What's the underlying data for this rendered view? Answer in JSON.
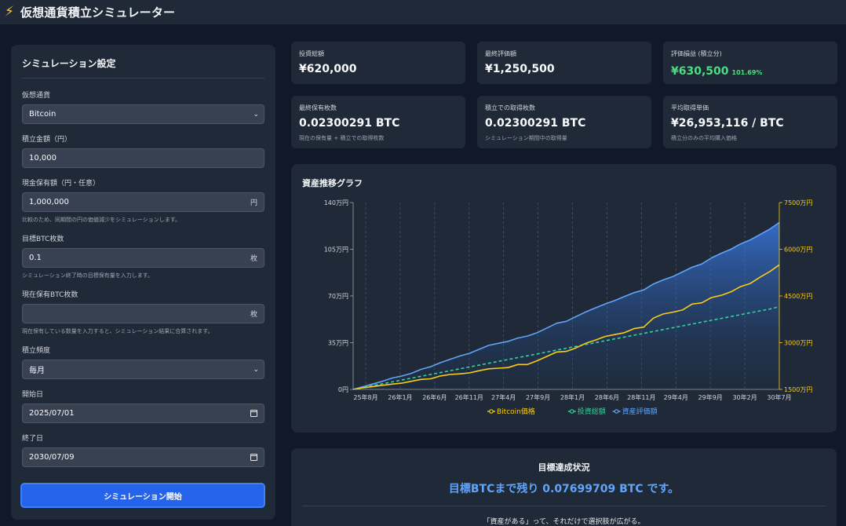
{
  "header": {
    "title": "仮想通貨積立シミュレーター",
    "icon": "lightning-bolt-icon"
  },
  "sidebar": {
    "title": "シミュレーション設定",
    "currency": {
      "label": "仮想通貨",
      "value": "Bitcoin"
    },
    "amount": {
      "label": "積立金額（円）",
      "value": "10,000"
    },
    "cash": {
      "label": "現金保有額（円・任意）",
      "value": "1,000,000",
      "suffix": "円",
      "hint": "比較のため、同期間の円の価値減少をシミュレーションします。"
    },
    "target": {
      "label": "目標BTC枚数",
      "value": "0.1",
      "suffix": "枚",
      "hint": "シミュレーション終了時の目標保有量を入力します。"
    },
    "holding": {
      "label": "現在保有BTC枚数",
      "value": "",
      "suffix": "枚",
      "hint": "現在保有している数量を入力すると、シミュレーション結果に合算されます。"
    },
    "frequency": {
      "label": "積立頻度",
      "value": "毎月"
    },
    "start": {
      "label": "開始日",
      "value": "2025/07/01"
    },
    "end": {
      "label": "終了日",
      "value": "2030/07/09"
    },
    "button": "シミュレーション開始"
  },
  "stats": {
    "invested": {
      "label": "投資総額",
      "value": "¥620,000"
    },
    "final_value": {
      "label": "最終評価額",
      "value": "¥1,250,500"
    },
    "gain": {
      "label": "評価損益 (積立分)",
      "value": "¥630,500",
      "pct": "101.69%"
    },
    "holdings": {
      "label": "最終保有枚数",
      "value": "0.02300291 BTC",
      "sub": "現在の保有量 + 積立での取得枚数"
    },
    "acquired": {
      "label": "積立での取得枚数",
      "value": "0.02300291 BTC",
      "sub": "シミュレーション期間中の取得量"
    },
    "avg_price": {
      "label": "平均取得単価",
      "value": "¥26,953,116 / BTC",
      "sub": "積立分のみの平均購入価格"
    }
  },
  "chart": {
    "title": "資産推移グラフ",
    "colors": {
      "price": "#facc15",
      "invested": "#34d399",
      "value": "#60a5fa"
    }
  },
  "chart_data": {
    "type": "line",
    "title": "資産推移グラフ",
    "x_ticks": [
      "25年8月",
      "26年1月",
      "26年6月",
      "26年11月",
      "27年4月",
      "27年9月",
      "28年1月",
      "28年6月",
      "28年11月",
      "29年4月",
      "29年9月",
      "30年2月",
      "30年7月"
    ],
    "y_left": {
      "ticks": [
        "0円",
        "35万円",
        "70万円",
        "105万円",
        "140万円"
      ],
      "range": [
        0,
        1400000
      ]
    },
    "y_right": {
      "ticks": [
        "1500万円",
        "3000万円",
        "4500万円",
        "6000万円",
        "7500万円"
      ],
      "range": [
        15000000,
        75000000
      ]
    },
    "legend": [
      "Bitcoin価格",
      "投資総額",
      "資産評価額"
    ],
    "legend_position": "bottom",
    "grid": true,
    "series": [
      {
        "name": "資産評価額",
        "axis": "left",
        "values": [
          0,
          20000,
          40000,
          60000,
          85000,
          100000,
          120000,
          150000,
          170000,
          200000,
          225000,
          250000,
          270000,
          300000,
          330000,
          345000,
          360000,
          385000,
          400000,
          425000,
          460000,
          495000,
          510000,
          545000,
          580000,
          610000,
          640000,
          665000,
          695000,
          725000,
          745000,
          790000,
          820000,
          845000,
          880000,
          915000,
          940000,
          985000,
          1020000,
          1050000,
          1090000,
          1120000,
          1160000,
          1200000,
          1250500
        ]
      },
      {
        "name": "投資総額",
        "axis": "left",
        "values": [
          0,
          14000,
          28000,
          42000,
          56000,
          70000,
          84000,
          98000,
          112000,
          126000,
          140000,
          154000,
          168000,
          182000,
          196000,
          210000,
          224000,
          238000,
          252000,
          266000,
          280000,
          294000,
          308000,
          322000,
          336000,
          350000,
          364000,
          378000,
          392000,
          406000,
          420000,
          434000,
          448000,
          462000,
          476000,
          490000,
          504000,
          518000,
          532000,
          546000,
          560000,
          574000,
          588000,
          602000,
          620000
        ]
      },
      {
        "name": "Bitcoin価格",
        "axis": "right",
        "values": [
          15000000,
          15500000,
          15900000,
          16300000,
          16700000,
          17000000,
          17600000,
          18200000,
          18400000,
          19300000,
          19800000,
          20000000,
          20300000,
          21000000,
          21600000,
          21800000,
          22000000,
          23000000,
          23000000,
          24200000,
          25600000,
          27000000,
          27200000,
          28300000,
          29800000,
          30800000,
          32000000,
          32600000,
          33200000,
          34500000,
          35000000,
          37900000,
          39200000,
          39800000,
          40500000,
          42400000,
          42800000,
          44500000,
          45200000,
          46300000,
          48000000,
          49000000,
          51000000,
          52800000,
          55000000
        ]
      }
    ]
  },
  "goal": {
    "title": "目標達成状況",
    "text": "目標BTCまで残り 0.07699709 BTC です。",
    "quote": "「資産がある」って、それだけで選択肢が広がる。"
  }
}
